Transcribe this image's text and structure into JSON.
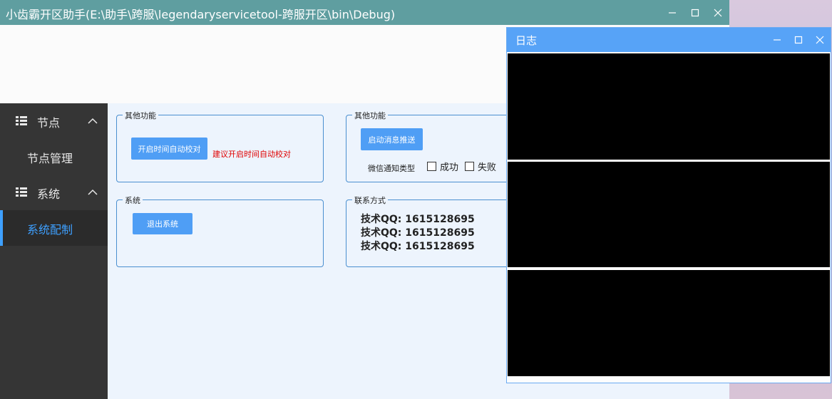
{
  "window": {
    "title": "小齿霸开区助手(E:\\助手\\跨服\\legendaryservicetool-跨服开区\\bin\\Debug)",
    "controls": [
      "minimize-icon",
      "maximize-icon",
      "close-icon"
    ]
  },
  "sidebar": {
    "groups": [
      {
        "label": "节点",
        "icon": "list-icon",
        "expanded": true,
        "items": [
          {
            "label": "节点管理",
            "active": false
          }
        ]
      },
      {
        "label": "系统",
        "icon": "list-icon",
        "expanded": true,
        "items": [
          {
            "label": "系统配制",
            "active": true
          }
        ]
      }
    ],
    "accent_color": "#3ea0ff"
  },
  "panels": {
    "other1": {
      "title": "其他功能",
      "button": "开启时间自动校对",
      "hint": "建议开启时间自动校对"
    },
    "other2": {
      "title": "其他功能",
      "button": "启动消息推送",
      "wechat_label": "微信通知类型",
      "checks": [
        {
          "label": "成功",
          "checked": false
        },
        {
          "label": "失败",
          "checked": false
        }
      ]
    },
    "system": {
      "title": "系统",
      "button": "退出系统"
    },
    "contact": {
      "title": "联系方式",
      "lines": [
        "技术QQ: 1615128695",
        "技术QQ: 1615128695",
        "技术QQ: 1615128695"
      ]
    }
  },
  "log_window": {
    "title": "日志",
    "pane_count": 3
  },
  "colors": {
    "titlebar": "#5f9ea0",
    "log_titlebar": "#57a3f7",
    "button": "#4f9ef5",
    "hint": "#e00000",
    "sidebar": "#353535",
    "content_bg": "#edf4fd"
  }
}
